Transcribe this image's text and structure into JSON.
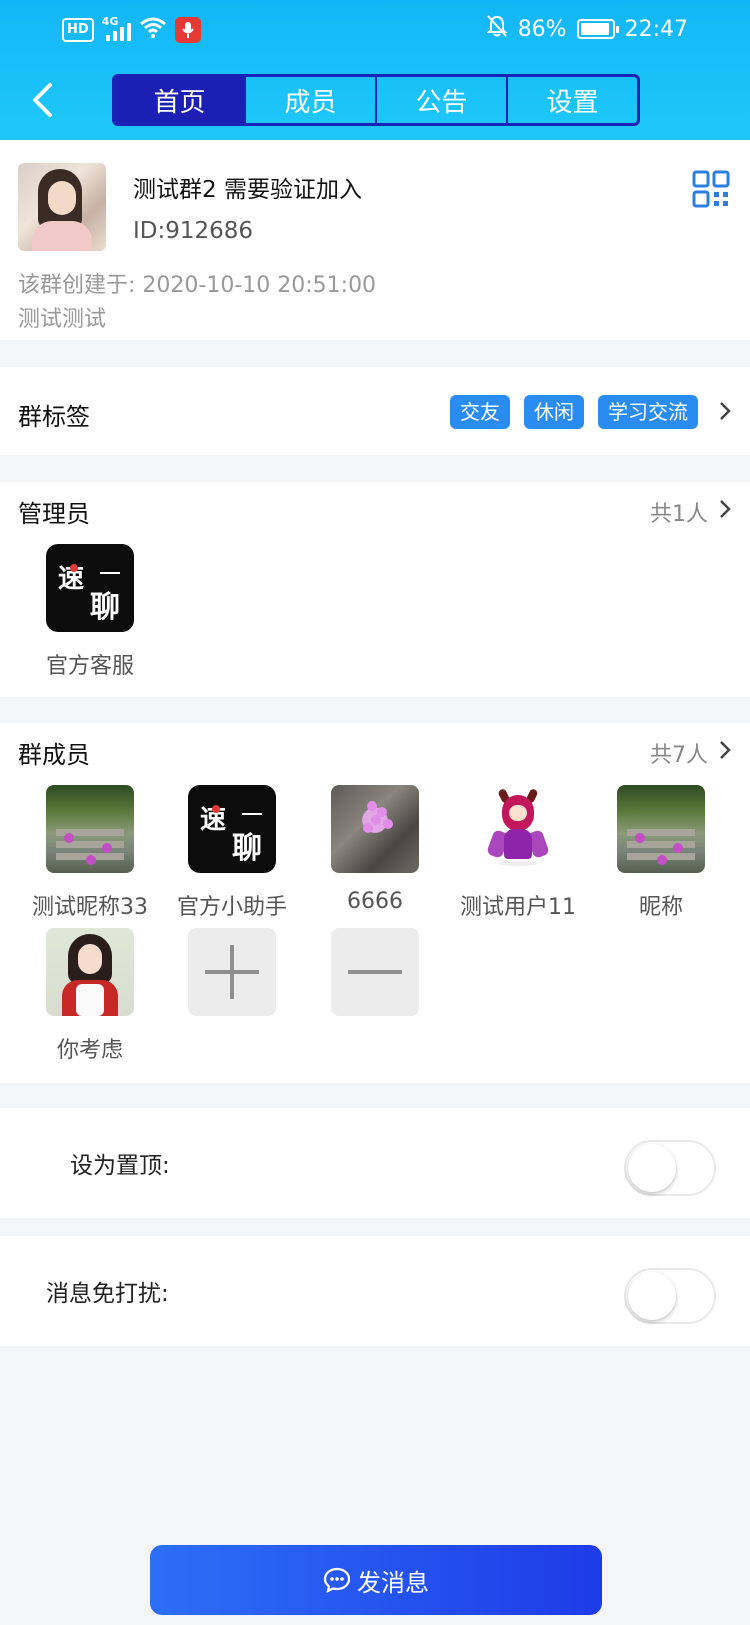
{
  "status_bar": {
    "hd": "HD",
    "net": "4G",
    "battery": "86%",
    "time": "22:47"
  },
  "tabs": [
    {
      "label": "首页",
      "active": true
    },
    {
      "label": "成员",
      "active": false
    },
    {
      "label": "公告",
      "active": false
    },
    {
      "label": "设置",
      "active": false
    }
  ],
  "group": {
    "title": "测试群2 需要验证加入",
    "id": "ID:912686",
    "created": "该群创建于: 2020-10-10 20:51:00",
    "description": "测试测试"
  },
  "tags_section": {
    "label": "群标签",
    "tags": [
      "交友",
      "休闲",
      "学习交流"
    ]
  },
  "admins_section": {
    "label": "管理员",
    "count": "共1人",
    "members": [
      {
        "name": "官方客服",
        "avatar": "suliao-logo"
      }
    ]
  },
  "members_section": {
    "label": "群成员",
    "count": "共7人",
    "members": [
      {
        "name": "测试昵称33",
        "avatar": "stairs-photo"
      },
      {
        "name": "官方小助手",
        "avatar": "suliao-logo"
      },
      {
        "name": "6666",
        "avatar": "flower-rocks-photo"
      },
      {
        "name": "测试用户11",
        "avatar": "anime-character"
      },
      {
        "name": "昵称",
        "avatar": "stairs-photo"
      },
      {
        "name": "你考虑",
        "avatar": "girl-photo"
      }
    ]
  },
  "settings": {
    "pin_label": "设为置顶:",
    "pin_on": false,
    "mute_label": "消息免打扰:",
    "mute_on": false
  },
  "send_button": {
    "label": "发消息"
  },
  "colors": {
    "header": "#12b6f6",
    "tab_active": "#1c1fb3",
    "tag": "#2a8cf0",
    "send_button": "#2d6ff6"
  }
}
